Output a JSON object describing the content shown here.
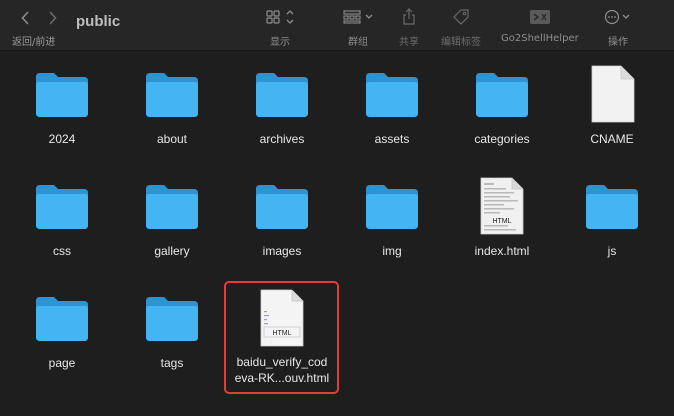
{
  "window": {
    "title": "public",
    "nav_label": "返回/前进"
  },
  "toolbar": {
    "view_label": "显示",
    "group_label": "群组",
    "share_label": "共享",
    "tags_label": "编辑标签",
    "go2shell_label": "Go2ShellHelper",
    "action_label": "操作"
  },
  "items": [
    {
      "name": "2024",
      "kind": "folder"
    },
    {
      "name": "about",
      "kind": "folder"
    },
    {
      "name": "archives",
      "kind": "folder"
    },
    {
      "name": "assets",
      "kind": "folder"
    },
    {
      "name": "categories",
      "kind": "folder"
    },
    {
      "name": "CNAME",
      "kind": "file"
    },
    {
      "name": "css",
      "kind": "folder"
    },
    {
      "name": "gallery",
      "kind": "folder"
    },
    {
      "name": "images",
      "kind": "folder"
    },
    {
      "name": "img",
      "kind": "folder"
    },
    {
      "name": "index.html",
      "kind": "html-preview",
      "badge": "HTML"
    },
    {
      "name": "js",
      "kind": "folder"
    },
    {
      "name": "page",
      "kind": "folder"
    },
    {
      "name": "tags",
      "kind": "folder"
    },
    {
      "name": "baidu_verify_codeva-RK...ouv.html",
      "name_line1": "baidu_verify_cod",
      "name_line2": "eva-RK...ouv.html",
      "kind": "html-file",
      "badge": "HTML",
      "selected": true
    }
  ],
  "colors": {
    "background": "#1e1e1e",
    "toolbar": "#262626",
    "folder": "#3fb0ef",
    "selection": "#e0402e"
  }
}
